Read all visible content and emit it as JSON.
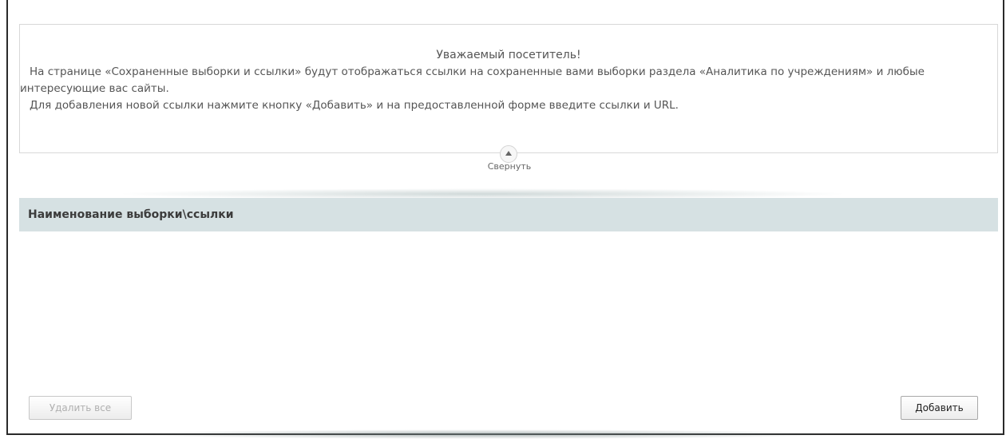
{
  "notice": {
    "title": "Уважаемый посетитель!",
    "paragraph1": "На странице «Сохраненные выборки и ссылки» будут отображаться ссылки на сохраненные вами выборки раздела «Аналитика по учреждениям» и любые интересующие вас сайты.",
    "paragraph2": "Для добавления новой ссылки нажмите кнопку «Добавить» и на предоставленной форме введите ссылки и URL.",
    "collapse_label": "Свернуть"
  },
  "table": {
    "column_header": "Наименование выборки\\ссылки",
    "rows": []
  },
  "buttons": {
    "delete_all": "Удалить все",
    "add": "Добавить"
  },
  "icons": {
    "collapse": "chevron-up-icon"
  },
  "colors": {
    "header_bg": "#d6e1e3",
    "text": "#555555"
  }
}
